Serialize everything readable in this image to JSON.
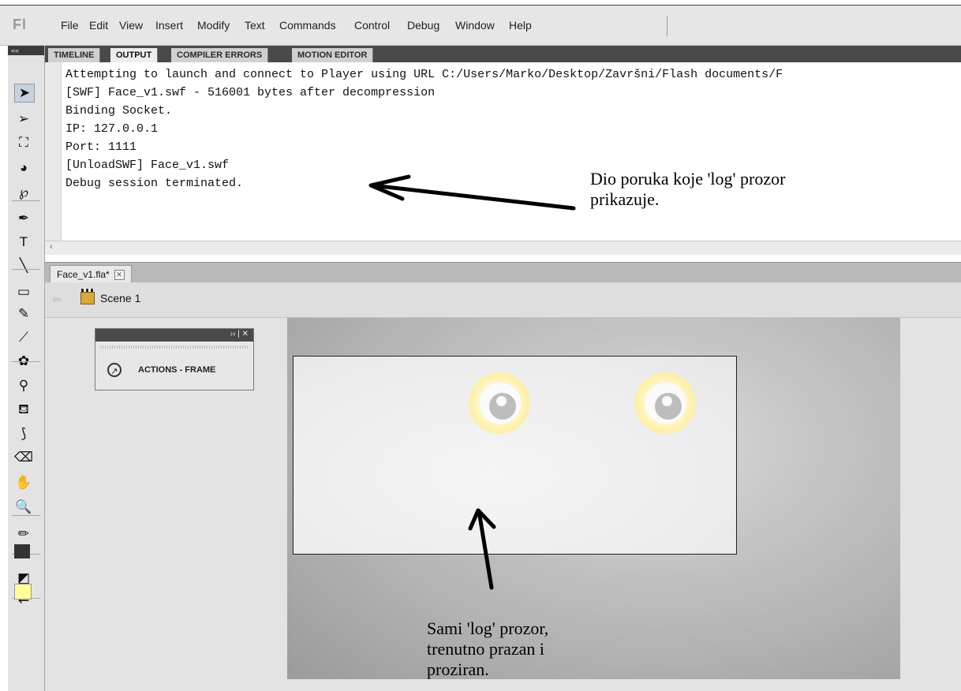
{
  "app": {
    "logo_text": "Fl"
  },
  "menu": {
    "items": [
      "File",
      "Edit",
      "View",
      "Insert",
      "Modify",
      "Text",
      "Commands",
      "Control",
      "Debug",
      "Window",
      "Help"
    ]
  },
  "toolbar": {
    "collapse_label": "««",
    "tools": [
      {
        "name": "selection-tool",
        "icon": "arrow-icon",
        "glyph": "➤",
        "selected": true
      },
      {
        "name": "subselection-tool",
        "icon": "subselect-arrow-icon",
        "glyph": "➢"
      },
      {
        "name": "free-transform-tool",
        "icon": "transform-icon",
        "glyph": "⛶"
      },
      {
        "name": "3d-rotation-tool",
        "icon": "sphere-icon",
        "glyph": "◕"
      },
      {
        "name": "lasso-tool",
        "icon": "lasso-icon",
        "glyph": "℘"
      },
      {
        "name": "pen-tool",
        "icon": "pen-nib-icon",
        "glyph": "✒"
      },
      {
        "name": "text-tool",
        "icon": "text-t-icon",
        "glyph": "T"
      },
      {
        "name": "line-tool",
        "icon": "line-icon",
        "glyph": "╲"
      },
      {
        "name": "rectangle-tool",
        "icon": "rectangle-icon",
        "glyph": "▭"
      },
      {
        "name": "pencil-tool",
        "icon": "pencil-icon",
        "glyph": "✎"
      },
      {
        "name": "brush-tool",
        "icon": "brush-icon",
        "glyph": "⟋"
      },
      {
        "name": "deco-tool",
        "icon": "deco-icon",
        "glyph": "✿"
      },
      {
        "name": "bone-tool",
        "icon": "bone-icon",
        "glyph": "⚲"
      },
      {
        "name": "paint-bucket-tool",
        "icon": "paint-bucket-icon",
        "glyph": "⛾"
      },
      {
        "name": "eyedropper-tool",
        "icon": "eyedropper-icon",
        "glyph": "⟆"
      },
      {
        "name": "eraser-tool",
        "icon": "eraser-icon",
        "glyph": "⌫"
      },
      {
        "name": "hand-tool",
        "icon": "hand-icon",
        "glyph": "✋"
      },
      {
        "name": "zoom-tool",
        "icon": "magnifier-icon",
        "glyph": "🔍"
      },
      {
        "name": "stroke-color-tool",
        "icon": "stroke-pencil-icon",
        "glyph": "✏"
      },
      {
        "name": "fill-color-tool",
        "icon": "fill-bucket-icon",
        "glyph": "⛾"
      },
      {
        "name": "default-colors-tool",
        "icon": "default-colors-icon",
        "glyph": "◩"
      },
      {
        "name": "swap-colors-tool",
        "icon": "swap-colors-icon",
        "glyph": "⇄"
      }
    ],
    "stroke_color": "#333333",
    "fill_color": "#ffff99"
  },
  "panel": {
    "tabs": [
      "TIMELINE",
      "OUTPUT",
      "COMPILER ERRORS",
      "MOTION EDITOR"
    ],
    "active_tab": "OUTPUT",
    "output_lines": [
      "Attempting to launch and connect to Player using URL C:/Users/Marko/Desktop/Završni/Flash documents/F",
      "[SWF] Face_v1.swf - 516001 bytes after decompression",
      "Binding Socket.",
      "IP: 127.0.0.1",
      "Port: 1111",
      "[UnloadSWF] Face_v1.swf",
      "Debug session terminated."
    ],
    "scroll_left": "‹"
  },
  "document": {
    "tab_label": "Face_v1.fla*",
    "tab_close": "✕",
    "back_label": "⇦",
    "scene_label": "Scene 1"
  },
  "actions_panel": {
    "title": "ACTIONS - FRAME",
    "controls": "›› | ✕",
    "icon_glyph": "↗"
  },
  "annotations": {
    "log_messages": [
      "Dio poruka koje 'log' prozor",
      "prikazuje."
    ],
    "log_window": [
      "Sami 'log' prozor,",
      "trenutno prazan i",
      "proziran."
    ]
  }
}
